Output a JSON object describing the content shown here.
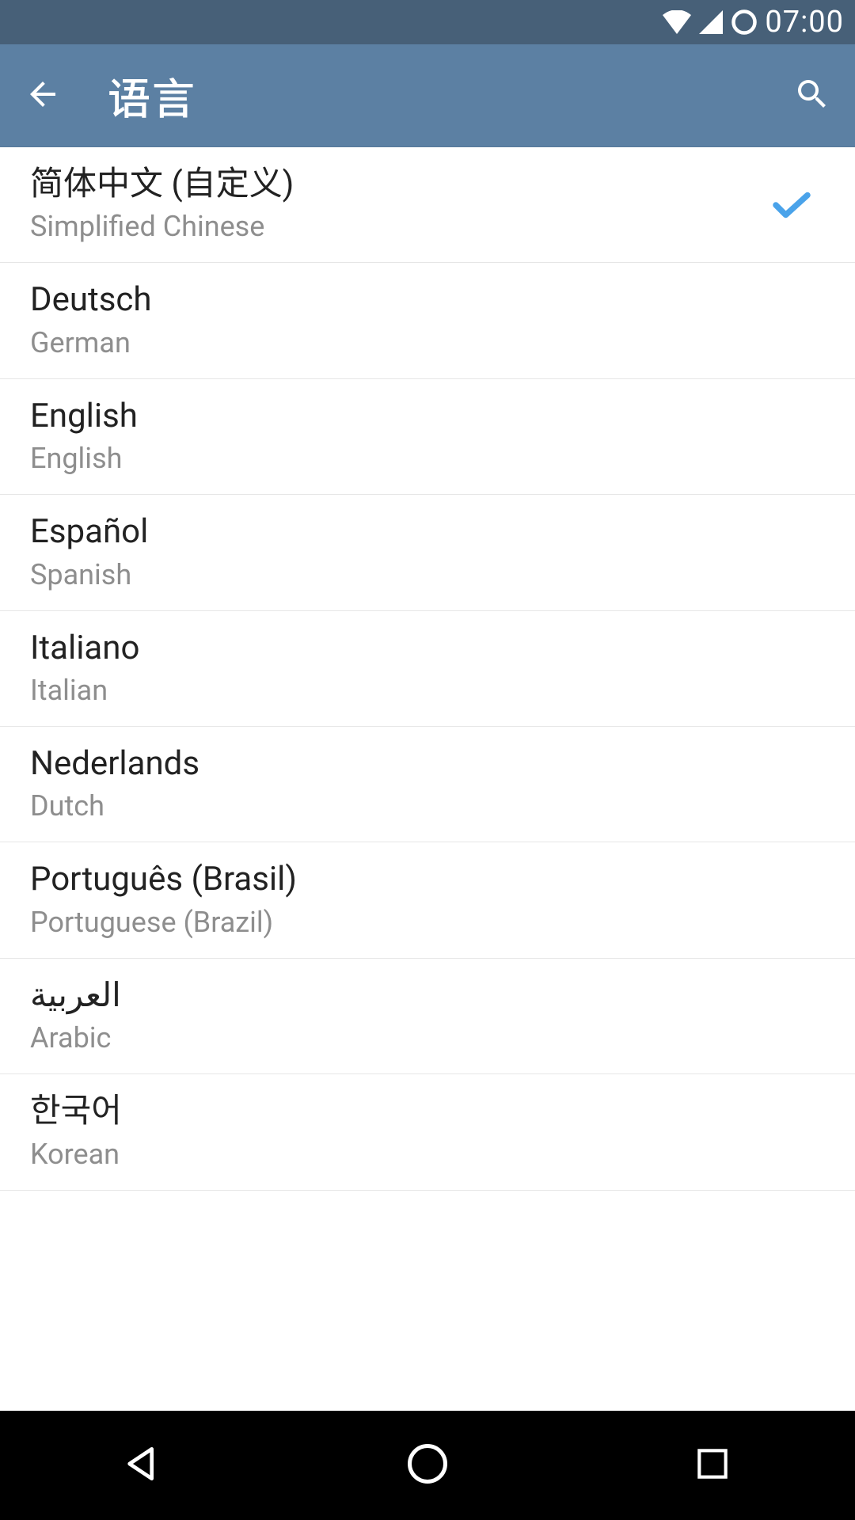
{
  "status": {
    "time": "07:00"
  },
  "header": {
    "title": "语言"
  },
  "languages": [
    {
      "native": "简体中文 (自定义)",
      "english": "Simplified Chinese",
      "selected": true
    },
    {
      "native": "Deutsch",
      "english": "German",
      "selected": false
    },
    {
      "native": "English",
      "english": "English",
      "selected": false
    },
    {
      "native": "Español",
      "english": "Spanish",
      "selected": false
    },
    {
      "native": "Italiano",
      "english": "Italian",
      "selected": false
    },
    {
      "native": "Nederlands",
      "english": "Dutch",
      "selected": false
    },
    {
      "native": "Português (Brasil)",
      "english": "Portuguese (Brazil)",
      "selected": false
    },
    {
      "native": "العربية",
      "english": "Arabic",
      "selected": false
    },
    {
      "native": "한국어",
      "english": "Korean",
      "selected": false
    }
  ]
}
